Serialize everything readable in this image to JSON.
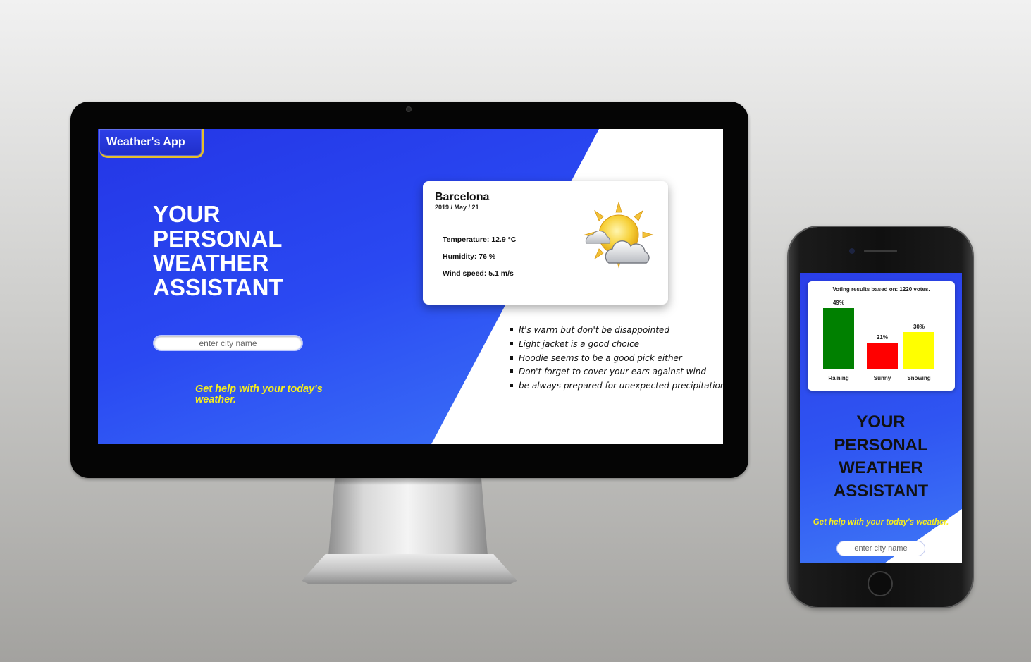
{
  "desktop": {
    "brand": "Weather's App",
    "hero_title": [
      "YOUR",
      "PERSONAL",
      "WEATHER",
      "ASSISTANT"
    ],
    "search_placeholder": "enter city name",
    "tagline": "Get help with your today's weather.",
    "weather_card": {
      "city": "Barcelona",
      "date": "2019 / May / 21",
      "temperature": "Temperature: 12.9 °C",
      "humidity": "Humidity: 76 %",
      "wind": "Wind speed: 5.1 m/s",
      "icon": "partly-cloudy-icon"
    },
    "tips": [
      "It's warm but don't be disappointed",
      "Light jacket is a good choice",
      "Hoodie seems to be a good pick either",
      "Don't forget to cover your ears against wind",
      "be always prepared for unexpected precipitation"
    ]
  },
  "mobile": {
    "vote_title": "Voting results based on: 1220 votes.",
    "chart_data": {
      "type": "bar",
      "title": "Voting results based on: 1220 votes.",
      "categories": [
        "Raining",
        "Sunny",
        "Snowing"
      ],
      "values": [
        49,
        21,
        30
      ],
      "labels": [
        "49%",
        "21%",
        "30%"
      ],
      "colors": [
        "#008000",
        "#ff0000",
        "#ffff00"
      ],
      "ylim": [
        0,
        60
      ]
    },
    "hero_title": [
      "YOUR",
      "PERSONAL",
      "WEATHER",
      "ASSISTANT"
    ],
    "tagline": "Get help with your today's weather.",
    "search_placeholder": "enter city name"
  },
  "colors": {
    "primary_blue": "#2a49f2",
    "accent_yellow": "#f6ee1d",
    "brand_border": "#e6c02a"
  }
}
